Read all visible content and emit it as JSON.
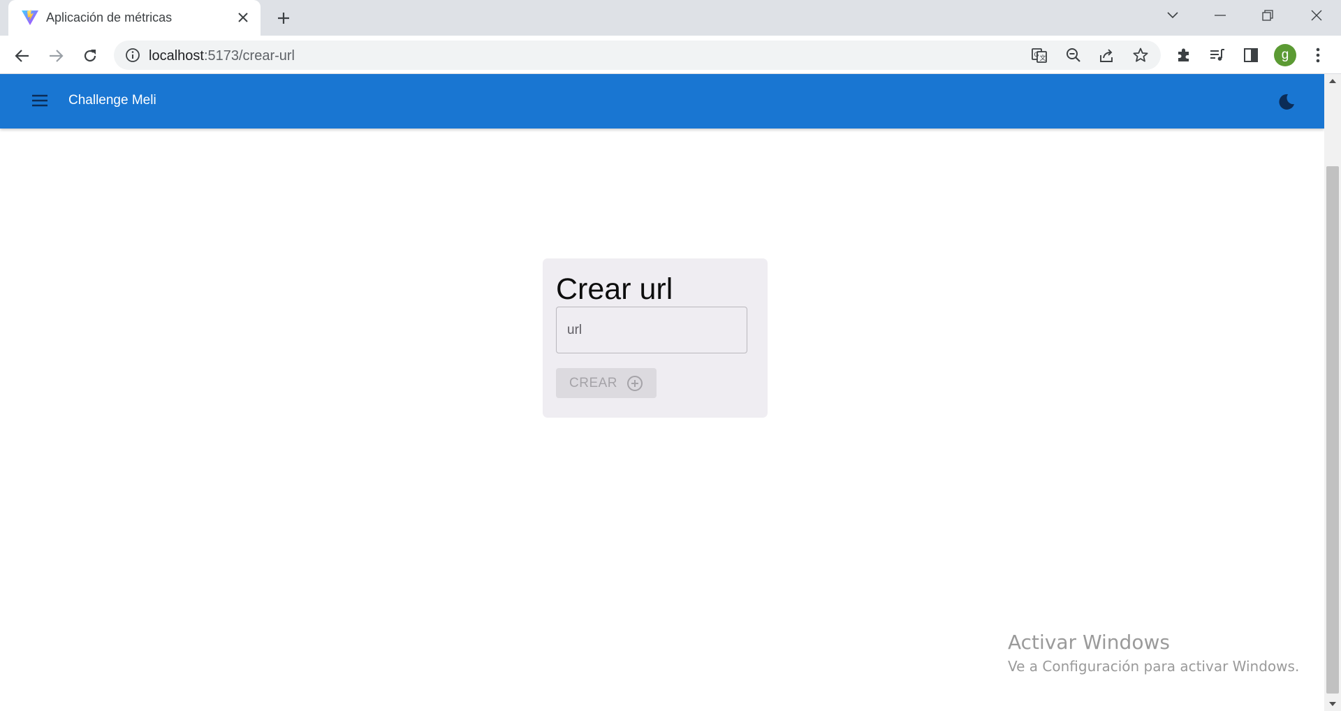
{
  "browser": {
    "tab_title": "Aplicación de métricas",
    "url_host": "localhost",
    "url_rest": ":5173/crear-url",
    "profile_initial": "g",
    "icons": {
      "favicon": "vite-logo-icon",
      "close": "close-icon",
      "new_tab": "plus-icon",
      "tab_search": "chevron-down-icon",
      "minimize": "minimize-icon",
      "restore": "restore-icon",
      "window_close": "close-icon",
      "back": "arrow-left-icon",
      "forward": "arrow-right-icon",
      "reload": "reload-icon",
      "site_info": "info-icon",
      "translate": "translate-icon",
      "zoom": "zoom-out-icon",
      "share": "share-icon",
      "bookmark": "star-icon",
      "extensions": "puzzle-icon",
      "media": "media-queue-icon",
      "side_panel": "side-panel-icon",
      "menu": "kebab-menu-icon"
    }
  },
  "app": {
    "title": "Challenge Meli",
    "colors": {
      "appbar": "#1976d2",
      "card": "#efedf2",
      "theme_icon": "#0b2c57"
    },
    "icons": {
      "menu": "hamburger-icon",
      "theme_toggle": "moon-icon"
    }
  },
  "form": {
    "heading": "Crear url",
    "url_placeholder": "url",
    "url_value": "",
    "create_label": "CREAR",
    "create_icon": "add-circle-icon",
    "create_disabled": true
  },
  "watermark": {
    "title": "Activar Windows",
    "subtitle": "Ve a Configuración para activar Windows."
  }
}
